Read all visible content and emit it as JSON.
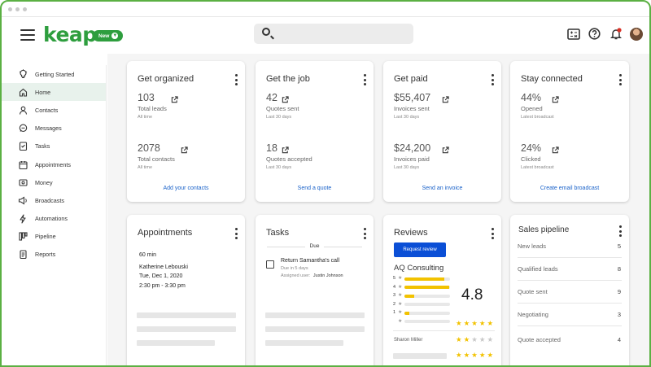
{
  "app": {
    "logo": "keap",
    "new_label": "New"
  },
  "search": {
    "placeholder": ""
  },
  "sidebar": {
    "items": [
      {
        "label": "Getting Started",
        "icon": "lightbulb-icon"
      },
      {
        "label": "Home",
        "icon": "home-icon"
      },
      {
        "label": "Contacts",
        "icon": "person-icon"
      },
      {
        "label": "Messages",
        "icon": "chat-icon"
      },
      {
        "label": "Tasks",
        "icon": "checklist-icon"
      },
      {
        "label": "Appointments",
        "icon": "calendar-icon"
      },
      {
        "label": "Money",
        "icon": "money-icon"
      },
      {
        "label": "Broadcasts",
        "icon": "megaphone-icon"
      },
      {
        "label": "Automations",
        "icon": "lightning-icon"
      },
      {
        "label": "Pipeline",
        "icon": "pipeline-icon"
      },
      {
        "label": "Reports",
        "icon": "report-icon"
      }
    ],
    "active": "Home"
  },
  "cards": {
    "organized": {
      "title": "Get organized",
      "m1_val": "103",
      "m1_lab": "Total leads",
      "m1_sub": "All time",
      "m2_val": "2078",
      "m2_lab": "Total contacts",
      "m2_sub": "All time",
      "link": "Add your contacts"
    },
    "job": {
      "title": "Get the job",
      "m1_val": "42",
      "m1_lab": "Quotes sent",
      "m1_sub": "Last 30 days",
      "m2_val": "18",
      "m2_lab": "Quotes accepted",
      "m2_sub": "Last 30 days",
      "link": "Send a quote"
    },
    "paid": {
      "title": "Get paid",
      "m1_val": "$55,407",
      "m1_lab": "Invoices sent",
      "m1_sub": "Last 30 days",
      "m2_val": "$24,200",
      "m2_lab": "Invoices paid",
      "m2_sub": "Last 30 days",
      "link": "Send an invoice"
    },
    "connected": {
      "title": "Stay connected",
      "m1_val": "44%",
      "m1_lab": "Opened",
      "m1_sub": "Latest broadcast",
      "m2_val": "24%",
      "m2_lab": "Clicked",
      "m2_sub": "Latest broadcast",
      "link": "Create email broadcast"
    },
    "appointments": {
      "title": "Appointments",
      "duration": "60 min",
      "name": "Katherine Lebouski",
      "date": "Tue, Dec 1, 2020",
      "time": "2:30 pm - 3:30 pm"
    },
    "tasks": {
      "title": "Tasks",
      "section": "Due",
      "task_title": "Return Samantha's call",
      "task_due": "Due in 5 days",
      "assigned_label": "Assigned user:",
      "assigned_user": "Justin Johnson"
    },
    "reviews": {
      "title": "Reviews",
      "button": "Request review",
      "company": "AQ Consulting",
      "score": "4.8",
      "reviewer": "Sharon Miller",
      "distribution": [
        {
          "stars": "5",
          "fill": 0.88
        },
        {
          "stars": "4",
          "fill": 0.98
        },
        {
          "stars": "3",
          "fill": 0.22
        },
        {
          "stars": "2",
          "fill": 0.0
        },
        {
          "stars": "1",
          "fill": 0.1
        },
        {
          "stars": "",
          "fill": 0.0
        }
      ],
      "rating_stars": 5,
      "review_stars": 2,
      "accent": "#f2c200"
    },
    "pipeline": {
      "title": "Sales pipeline",
      "rows": [
        {
          "label": "New leads",
          "count": "5"
        },
        {
          "label": "Qualified leads",
          "count": "8"
        },
        {
          "label": "Quote sent",
          "count": "9"
        },
        {
          "label": "Negotiating",
          "count": "3"
        },
        {
          "label": "Quote accepted",
          "count": "4"
        }
      ]
    }
  },
  "colors": {
    "brand": "#2e9e3e",
    "link": "#1a62c9",
    "active_bg": "#e8f2ec",
    "button_blue": "#0b4fd6"
  }
}
